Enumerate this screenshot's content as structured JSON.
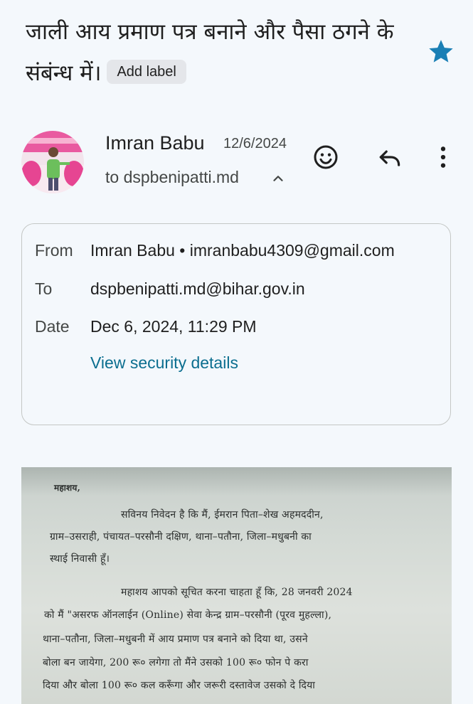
{
  "email": {
    "subject": "जाली आय प्रमाण पत्र बनाने और पैसा ठगने के संबंन्ध में।",
    "add_label": "Add label",
    "starred": true,
    "star_color": "#1a7fb5",
    "sender": {
      "name": "Imran Babu",
      "date": "12/6/2024",
      "to_line": "to dspbenipatti.md"
    },
    "actions": {
      "emoji_icon": "smiley-icon",
      "reply_icon": "reply-icon",
      "more_icon": "more-vert-icon"
    },
    "details": {
      "from_label": "From",
      "from_value": "Imran Babu • imranbabu4309@gmail.com",
      "to_label": "To",
      "to_value": "dspbenipatti.md@bihar.gov.in",
      "date_label": "Date",
      "date_value": "Dec 6, 2024, 11:29 PM",
      "security_link": "View security details"
    },
    "attachment_text": {
      "salutation": "महाशय,",
      "p1_line1": "सविनय निवेदन है कि मैं, ईमरान पिता–शेख अहमददीन,",
      "p1_line2": "ग्राम–उसराही, पंचायत–परसौनी दक्षिण, थाना–पतौना, जिला–मधुबनी का",
      "p1_line3": "स्थाई निवासी हूँ।",
      "p2_line1": "महाशय आपको सूचित करना चाहता हूँ कि, 28 जनवरी 2024",
      "p2_line2": "को मैं \"असरफ ऑनलाईन (Online) सेवा केन्द्र ग्राम–परसौनी (पूरव मुहल्ला),",
      "p2_line3": "थाना–पतौना, जिला–मधुबनी में आय प्रमाण पत्र बनाने को दिया था, उसने",
      "p2_line4": "बोला बन जायेगा, 200 रू० लगेगा तो मैंने उसको 100 रू० फोन पे करा",
      "p2_line5": "दिया और बोला 100 रू० कल करूँगा और जरूरी दस्तावेज उसको दे दिया"
    }
  }
}
